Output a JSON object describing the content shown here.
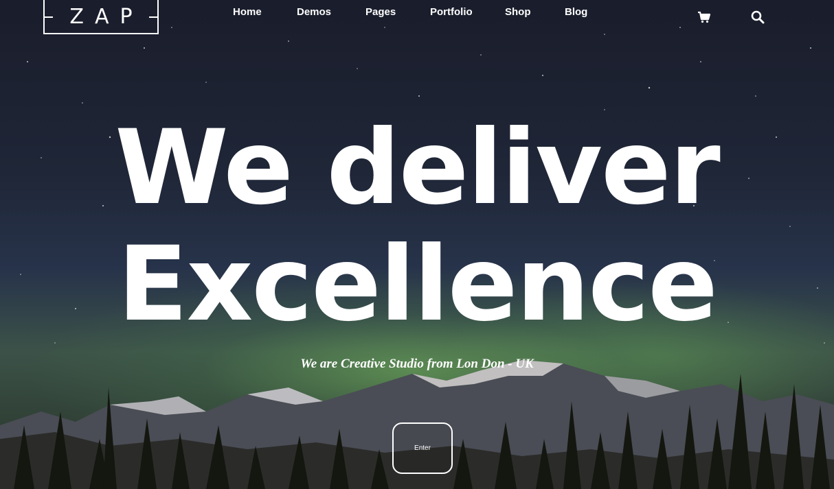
{
  "brand": {
    "logo_text": "ZAP"
  },
  "nav": {
    "items": [
      {
        "label": "Home"
      },
      {
        "label": "Demos"
      },
      {
        "label": "Pages"
      },
      {
        "label": "Portfolio"
      },
      {
        "label": "Shop"
      },
      {
        "label": "Blog"
      }
    ],
    "icons": [
      "cart-icon",
      "search-icon"
    ]
  },
  "hero": {
    "headline_line1": "We deliver",
    "headline_line2": "Excellence",
    "tagline": "We are Creative Studio from Lon Don - UK",
    "enter_label": "Enter"
  },
  "colors": {
    "text": "#ffffff",
    "sky_top": "#1a1d2b",
    "aurora": "#78be5f"
  }
}
